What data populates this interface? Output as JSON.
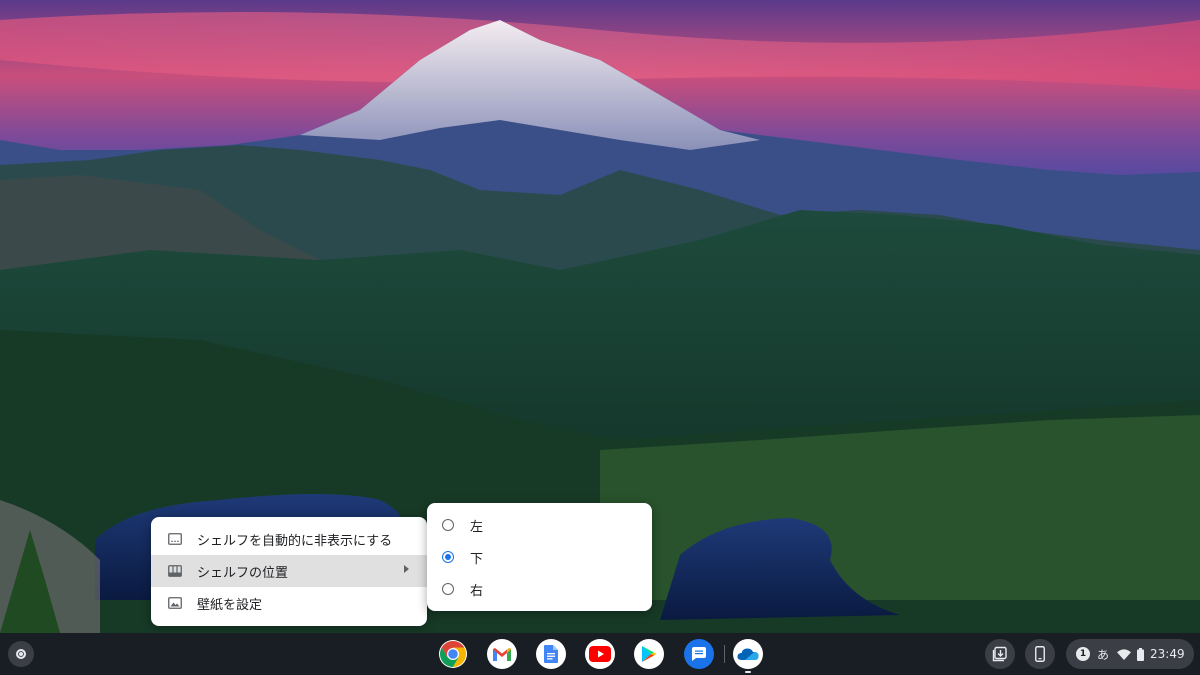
{
  "context_menu": {
    "items": [
      {
        "label": "シェルフを自動的に非表示にする",
        "icon": "autohide-icon"
      },
      {
        "label": "シェルフの位置",
        "icon": "shelf-position-icon",
        "has_submenu": true,
        "highlighted": true
      },
      {
        "label": "壁紙を設定",
        "icon": "wallpaper-icon"
      }
    ]
  },
  "submenu": {
    "options": [
      {
        "label": "左",
        "checked": false
      },
      {
        "label": "下",
        "checked": true
      },
      {
        "label": "右",
        "checked": false
      }
    ]
  },
  "shelf": {
    "apps": [
      {
        "name": "chrome-app-icon"
      },
      {
        "name": "gmail-app-icon"
      },
      {
        "name": "docs-app-icon"
      },
      {
        "name": "youtube-app-icon"
      },
      {
        "name": "play-store-app-icon"
      },
      {
        "name": "messages-app-icon"
      },
      {
        "name": "onedrive-app-icon",
        "running": true
      }
    ]
  },
  "status_tray": {
    "notification_count": "1",
    "ime": "あ",
    "time": "23:49"
  },
  "colors": {
    "accent": "#1a73e8",
    "menu_highlight": "#e0e0e0",
    "shelf_bg": "#1a1e24"
  }
}
